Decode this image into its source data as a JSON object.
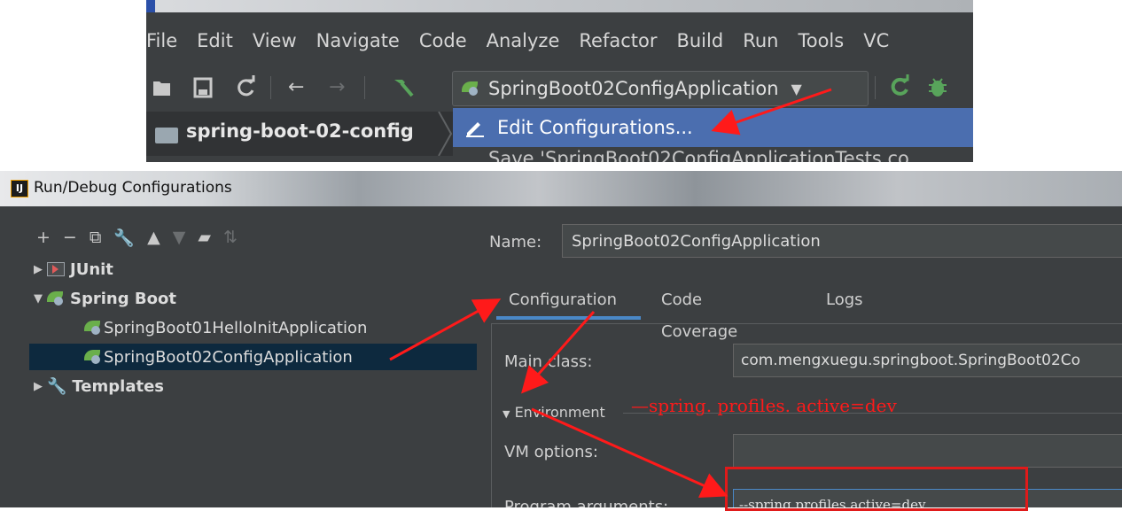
{
  "ide": {
    "menu": [
      "File",
      "Edit",
      "View",
      "Navigate",
      "Code",
      "Analyze",
      "Refactor",
      "Build",
      "Run",
      "Tools",
      "VC"
    ],
    "run_config_selector": "SpringBoot02ConfigApplication",
    "project_name": "spring-boot-02-config",
    "dropdown": {
      "edit_configurations": "Edit Configurations...",
      "save_item": "Save 'SpringBoot02ConfigApplicationTests co"
    }
  },
  "dialog": {
    "title": "Run/Debug Configurations",
    "tree": {
      "junit": "JUnit",
      "spring_boot": "Spring Boot",
      "app1": "SpringBoot01HelloInitApplication",
      "app2": "SpringBoot02ConfigApplication",
      "templates": "Templates"
    },
    "name_label": "Name:",
    "name_value": "SpringBoot02ConfigApplication",
    "tabs": [
      "Configuration",
      "Code Coverage",
      "Logs"
    ],
    "main_class_label": "Main class:",
    "main_class_value": "com.mengxuegu.springboot.SpringBoot02Co",
    "environment_label": "Environment",
    "vm_options_label": "VM options:",
    "program_arguments_label": "Program arguments:",
    "program_arguments_value": "--spring.profiles.active=dev"
  },
  "annotation": {
    "text": "—spring. profiles. active=dev"
  },
  "colors": {
    "accent": "#4b6eaf",
    "annotation_red": "#ff1a1a",
    "panel_bg": "#3c3f41"
  }
}
